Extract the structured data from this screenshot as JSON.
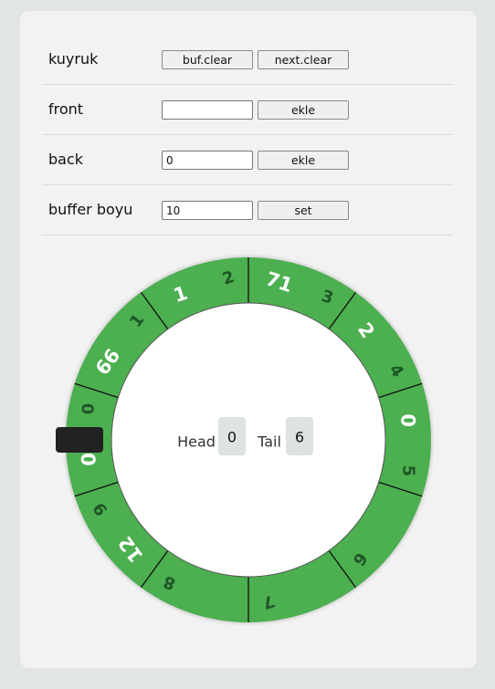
{
  "rows": {
    "kuyruk": {
      "label": "kuyruk",
      "buf_clear": "buf.clear",
      "next_clear": "next.clear"
    },
    "front": {
      "label": "front",
      "value": "",
      "button": "ekle"
    },
    "back": {
      "label": "back",
      "value": "0",
      "button": "ekle"
    },
    "buffer": {
      "label": "buffer boyu",
      "value": "10",
      "button": "set"
    }
  },
  "ring": {
    "head_label": "Head",
    "head_value": "0",
    "tail_label": "Tail",
    "tail_value": "6",
    "slot_values": [
      "0",
      "66",
      "1",
      "71",
      "2",
      "0",
      "",
      "",
      "",
      "12"
    ],
    "slot_indexes": [
      "0",
      "1",
      "2",
      "3",
      "4",
      "5",
      "6",
      "7",
      "8",
      "9"
    ],
    "colors": {
      "ring": "#4caf50",
      "index": "#1e5626",
      "value": "#ffffff",
      "marker": "#222222"
    }
  }
}
